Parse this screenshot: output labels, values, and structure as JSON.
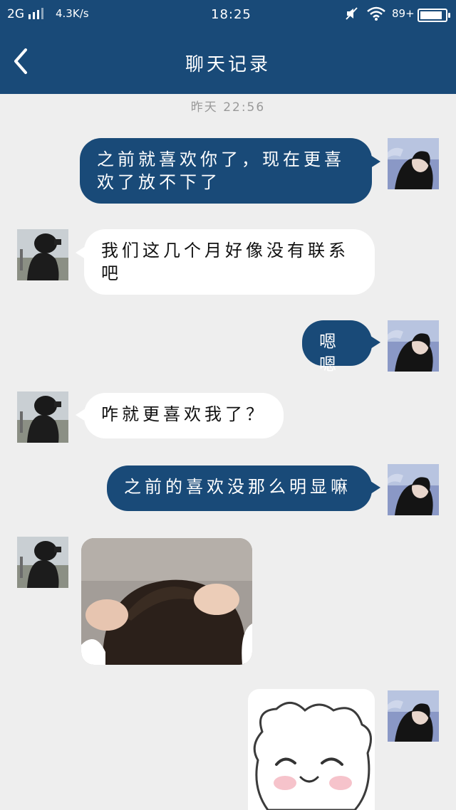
{
  "status_bar": {
    "network": "2G",
    "speed": "4.3K/s",
    "time": "18:25",
    "battery": "89",
    "battery_level_percent": 89
  },
  "header": {
    "title": "聊天记录",
    "back_icon": "chevron-left-icon"
  },
  "timestamp": "昨天 22:56",
  "messages": [
    {
      "side": "right",
      "text": "之前就喜欢你了，现在更喜欢了放不下了"
    },
    {
      "side": "left",
      "text": "我们这几个月好像没有联系吧"
    },
    {
      "side": "right",
      "text": "嗯嗯"
    },
    {
      "side": "left",
      "text": "咋就更喜欢我了？"
    },
    {
      "side": "right",
      "text": "之前的喜欢没那么明显嘛"
    },
    {
      "side": "left",
      "type": "image",
      "image": "baby-scratching-head-photo"
    },
    {
      "side": "right",
      "type": "image",
      "image": "cartoon-smiling-face-sticker"
    }
  ],
  "colors": {
    "header": "#194a78",
    "self_bubble": "#194a78",
    "other_bubble": "#ffffff",
    "background": "#eeeeee"
  }
}
